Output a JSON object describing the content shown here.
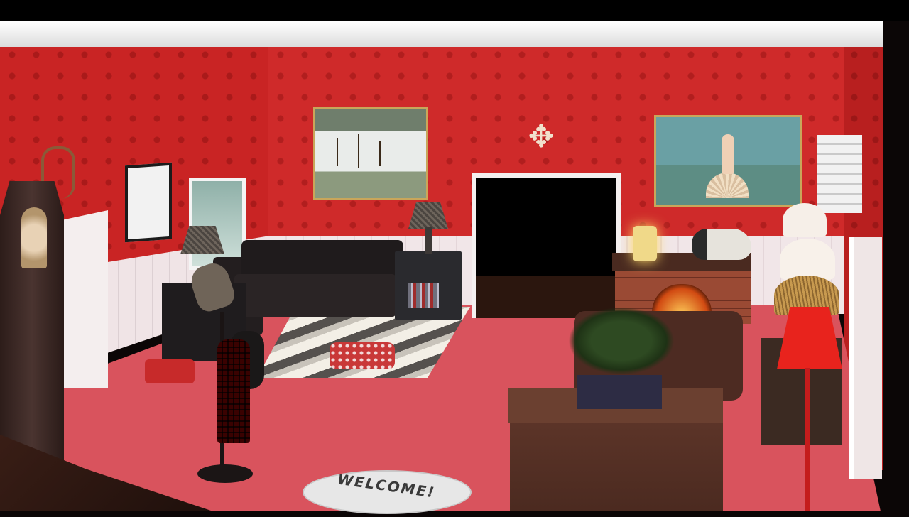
{
  "scene": {
    "welcome_mat": {
      "text": "WELCOME!"
    },
    "ornament_glyph": "✥",
    "colors": {
      "wall": "#cf2a2a",
      "floor": "#d9535d",
      "wainscot": "#f1e6e8",
      "trim": "#ffffff"
    }
  }
}
